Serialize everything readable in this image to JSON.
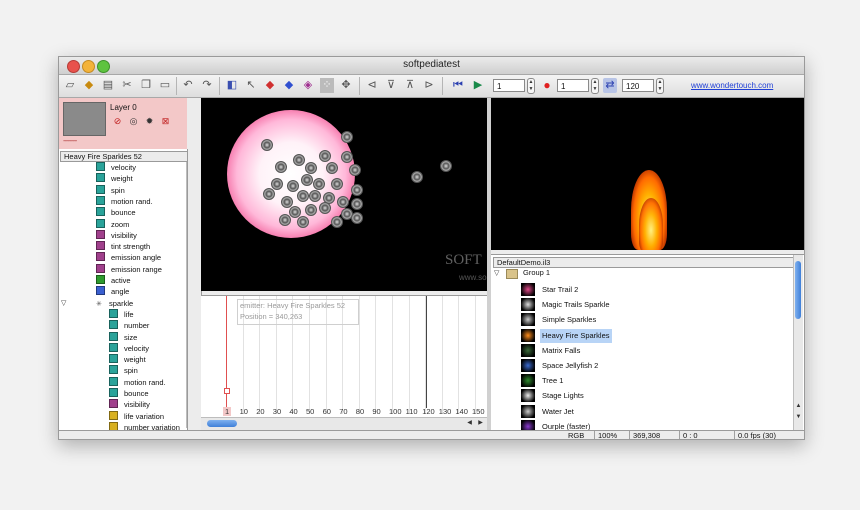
{
  "window": {
    "title": "softpediatest"
  },
  "toolbar": {
    "field1": "1",
    "field2": "1",
    "field3": "120",
    "link": "www.wondertouch.com",
    "icons": [
      "new-icon",
      "open-icon",
      "save-icon",
      "cut-icon",
      "copy-icon",
      "paste-icon",
      "undo-icon",
      "redo-icon",
      "emitter-icon",
      "select-icon",
      "shape-icon",
      "layer-icon",
      "particle-icon",
      "grid-icon",
      "move-icon",
      "nav-left-icon",
      "nav-down-icon",
      "nav-up-icon",
      "nav-right-icon",
      "rewind-icon",
      "play-icon",
      "record-icon",
      "loop-icon"
    ]
  },
  "layer": {
    "name": "Layer 0",
    "dashes": "--------"
  },
  "tree": {
    "header": "Heavy Fire Sparkles 52",
    "items": [
      {
        "label": "velocity",
        "indent": 1,
        "color": "#2aa39a"
      },
      {
        "label": "weight",
        "indent": 1,
        "color": "#2aa39a"
      },
      {
        "label": "spin",
        "indent": 1,
        "color": "#2aa39a"
      },
      {
        "label": "motion rand.",
        "indent": 1,
        "color": "#2aa39a"
      },
      {
        "label": "bounce",
        "indent": 1,
        "color": "#2aa39a"
      },
      {
        "label": "zoom",
        "indent": 1,
        "color": "#2aa39a"
      },
      {
        "label": "visibility",
        "indent": 1,
        "color": "#a0408c"
      },
      {
        "label": "tint strength",
        "indent": 1,
        "color": "#a0408c"
      },
      {
        "label": "emission angle",
        "indent": 1,
        "color": "#a0408c"
      },
      {
        "label": "emission range",
        "indent": 1,
        "color": "#a0408c"
      },
      {
        "label": "active",
        "indent": 1,
        "color": "#2e9a2e"
      },
      {
        "label": "angle",
        "indent": 1,
        "color": "#3a5fd0"
      },
      {
        "label": "sparkle",
        "indent": 1,
        "color": "none"
      },
      {
        "label": "life",
        "indent": 2,
        "color": "#2aa39a"
      },
      {
        "label": "number",
        "indent": 2,
        "color": "#2aa39a"
      },
      {
        "label": "size",
        "indent": 2,
        "color": "#2aa39a"
      },
      {
        "label": "velocity",
        "indent": 2,
        "color": "#2aa39a"
      },
      {
        "label": "weight",
        "indent": 2,
        "color": "#2aa39a"
      },
      {
        "label": "spin",
        "indent": 2,
        "color": "#2aa39a"
      },
      {
        "label": "motion rand.",
        "indent": 2,
        "color": "#2aa39a"
      },
      {
        "label": "bounce",
        "indent": 2,
        "color": "#2aa39a"
      },
      {
        "label": "visibility",
        "indent": 2,
        "color": "#a0408c"
      },
      {
        "label": "life variation",
        "indent": 2,
        "color": "#d8b020"
      },
      {
        "label": "number variation",
        "indent": 2,
        "color": "#d8b020"
      }
    ]
  },
  "stage": {
    "watermark": "SOFT",
    "watermark_url": "www.so"
  },
  "timeline": {
    "info_line1": "emitter:  Heavy Fire Sparkles 52",
    "info_line2": "Position = 340,263",
    "ticks": [
      "1",
      "10",
      "20",
      "30",
      "40",
      "50",
      "60",
      "70",
      "80",
      "90",
      "100",
      "110",
      "120",
      "130",
      "140",
      "150"
    ]
  },
  "library": {
    "header": "DefaultDemo.il3",
    "group": "Group 1",
    "items": [
      {
        "label": "Star Trail 2",
        "thumb": "#e24a8a",
        "selected": false
      },
      {
        "label": "Magic Trails Sparkle",
        "thumb": "#ddd",
        "selected": false
      },
      {
        "label": "Simple Sparkles",
        "thumb": "#ccc",
        "selected": false
      },
      {
        "label": "Heavy Fire Sparkles",
        "thumb": "#ff8c1a",
        "selected": true
      },
      {
        "label": "Matrix Falls",
        "thumb": "#3a6a3a",
        "selected": false
      },
      {
        "label": "Space Jellyfish 2",
        "thumb": "#3a6ad0",
        "selected": false
      },
      {
        "label": "Tree 1",
        "thumb": "#2e8a2e",
        "selected": false
      },
      {
        "label": "Stage Lights",
        "thumb": "#eee",
        "selected": false
      },
      {
        "label": "Water Jet",
        "thumb": "#ccc",
        "selected": false
      },
      {
        "label": "Ourple (faster)",
        "thumb": "#8a3ad0",
        "selected": false
      }
    ]
  },
  "status": {
    "mode": "RGB",
    "zoom": "100%",
    "coords": "369,308",
    "time": "0 : 0",
    "fps": "0.0 fps (30)"
  }
}
